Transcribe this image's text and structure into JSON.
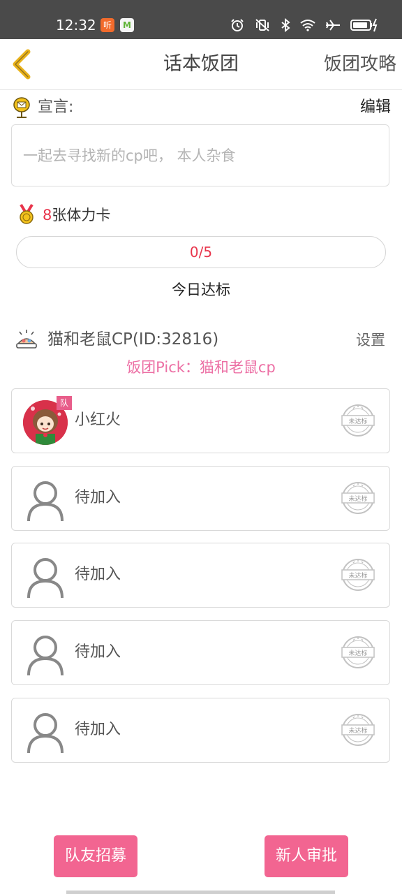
{
  "status_bar": {
    "time": "12:32",
    "app1_glyph": "听",
    "app2_glyph": "M",
    "icons": [
      "alarm-icon",
      "vibrate-icon",
      "bluetooth-icon",
      "wifi-icon",
      "airplane-icon",
      "battery-charging-icon"
    ]
  },
  "nav": {
    "title": "话本饭团",
    "right_action": "饭团攻略",
    "back_icon": "chevron-left-icon"
  },
  "manifesto": {
    "label": "宣言:",
    "edit": "编辑",
    "text": "一起去寻找新的cp吧， 本人杂食"
  },
  "stamina": {
    "count": "8",
    "suffix": "张体力卡",
    "progress_text": "0/5",
    "progress_value": 0,
    "progress_max": 5,
    "today_label": "今日达标"
  },
  "team": {
    "name": "猫和老鼠CP(ID:32816)",
    "settings": "设置",
    "pick": "饭团Pick：猫和老鼠cp",
    "members": [
      {
        "name": "小红火",
        "badge": "队",
        "stamp": "未达标",
        "is_leader": true
      },
      {
        "name": "待加入",
        "stamp": "未达标",
        "is_leader": false
      },
      {
        "name": "待加入",
        "stamp": "未达标",
        "is_leader": false
      },
      {
        "name": "待加入",
        "stamp": "未达标",
        "is_leader": false
      },
      {
        "name": "待加入",
        "stamp": "未达标",
        "is_leader": false
      }
    ]
  },
  "actions": {
    "recruit": "队友招募",
    "approve": "新人审批"
  },
  "colors": {
    "accent_pink": "#f26591",
    "pick_pink": "#ec6fa4",
    "number_red": "#e8344b",
    "back_yellow": "#e9b21b"
  }
}
